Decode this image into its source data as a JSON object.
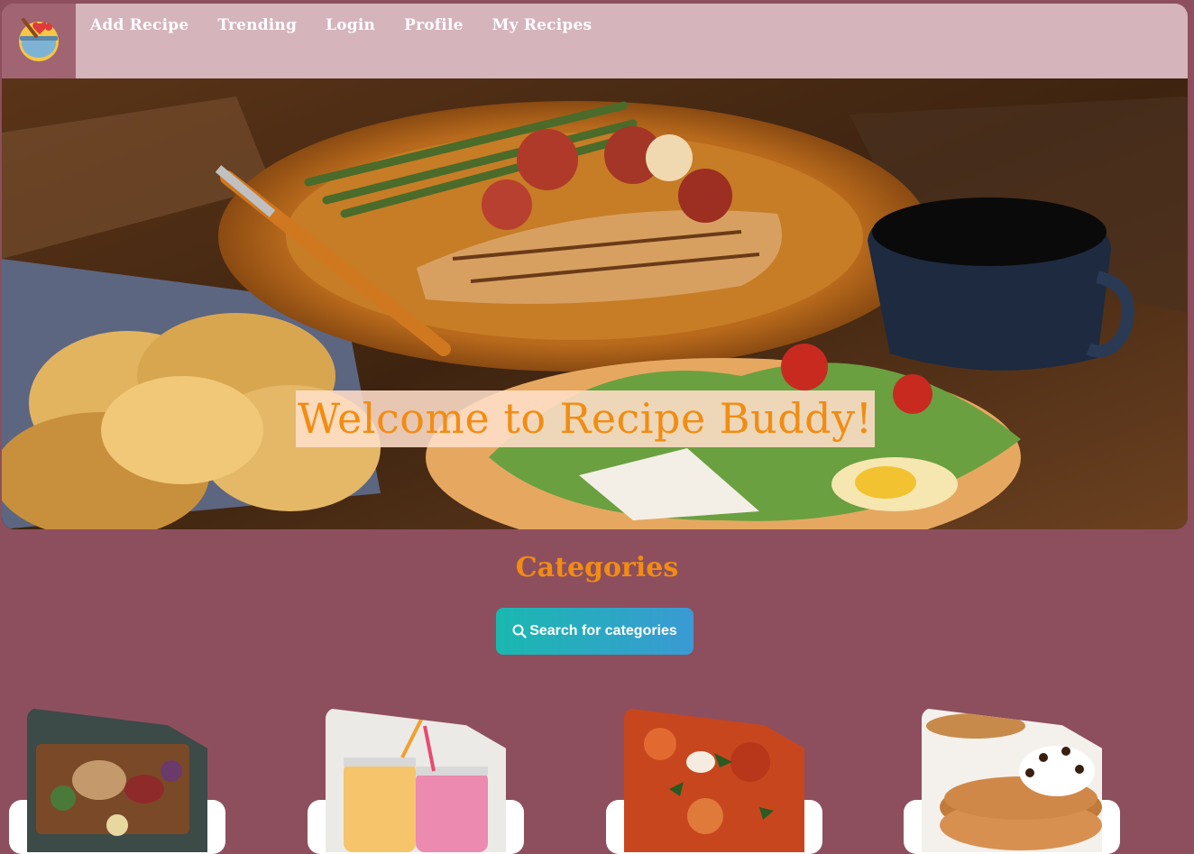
{
  "nav": {
    "logo_icon": "cooking-pot-logo-icon",
    "links": [
      "Add Recipe",
      "Trending",
      "Login",
      "Profile",
      "My Recipes"
    ]
  },
  "hero": {
    "title": "Welcome to Recipe Buddy!",
    "image": "grilled-fish-dinner-photo"
  },
  "categories": {
    "title": "Categories",
    "search_button_label": "Search for categories",
    "search_icon": "search-icon",
    "cards": [
      {
        "image": "charcuterie-board-photo"
      },
      {
        "image": "smoothies-photo"
      },
      {
        "image": "pizza-photo"
      },
      {
        "image": "pancakes-photo"
      }
    ]
  },
  "colors": {
    "background": "#8d4f5e",
    "navbar": "#d5b4bc",
    "accent": "#f28c12",
    "button_gradient_start": "#1ab8b0",
    "button_gradient_end": "#3a9ad4"
  }
}
